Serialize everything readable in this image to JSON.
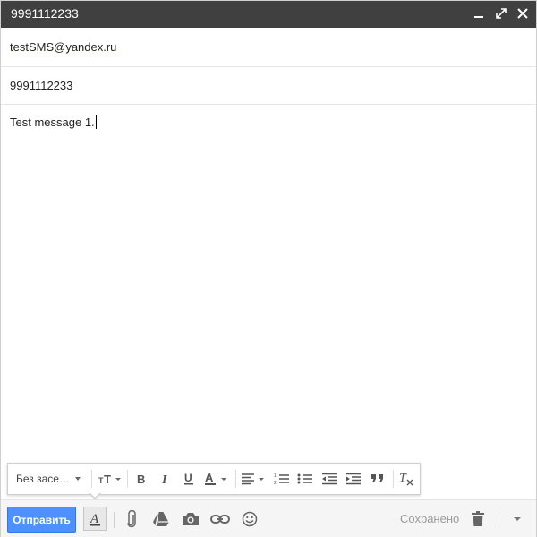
{
  "window": {
    "title": "9991112233",
    "controls": [
      "minimize-icon",
      "expand-icon",
      "close-icon"
    ]
  },
  "compose": {
    "to": "testSMS@yandex.ru",
    "subject": "9991112233",
    "body": "Test message 1."
  },
  "formatting": {
    "font": "Без засе…",
    "icons": [
      "font-size-icon",
      "bold-icon",
      "italic-icon",
      "underline-icon",
      "text-color-icon",
      "align-icon",
      "numbered-list-icon",
      "bulleted-list-icon",
      "indent-less-icon",
      "indent-more-icon",
      "quote-icon",
      "clear-formatting-icon"
    ]
  },
  "toolbar": {
    "send_label": "Отправить",
    "saved_label": "Сохранено",
    "icons": [
      "formatting-options-icon",
      "attach-icon",
      "drive-icon",
      "photo-icon",
      "link-icon",
      "emoji-icon",
      "trash-icon",
      "more-options-icon"
    ]
  },
  "colors": {
    "titlebar": "#404040",
    "send_button": "#4d90fe",
    "bottom_bar": "#f5f5f5"
  }
}
